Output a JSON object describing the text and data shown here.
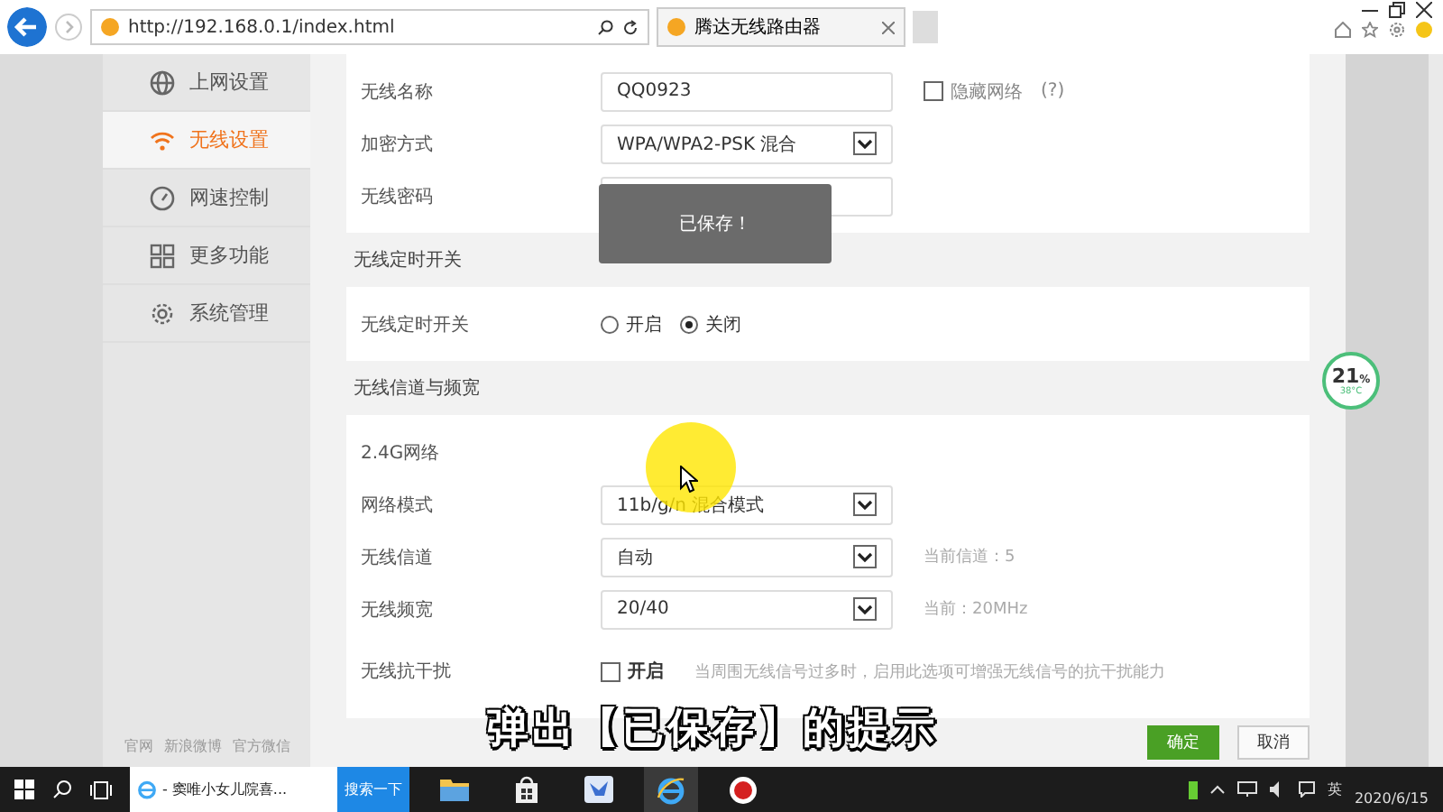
{
  "browser": {
    "address": "http://192.168.0.1/index.html",
    "tabs": [
      {
        "title": "腾达无线路由器"
      }
    ]
  },
  "sidebar": {
    "items": [
      {
        "label": "上网设置",
        "selected": false
      },
      {
        "label": "无线设置",
        "selected": true
      },
      {
        "label": "网速控制",
        "selected": false
      },
      {
        "label": "更多功能",
        "selected": false
      },
      {
        "label": "系统管理",
        "selected": false
      }
    ],
    "footer_links": [
      "官网",
      "新浪微博",
      "官方微信"
    ]
  },
  "sections": [
    {
      "rows": [
        {
          "kind": "input",
          "label": "无线名称",
          "value": "QQ0923",
          "checkbox": {
            "label": "隐藏网络",
            "checked": false,
            "help": "(?)"
          }
        },
        {
          "kind": "select",
          "label": "加密方式",
          "value": "WPA/WPA2-PSK 混合"
        },
        {
          "kind": "password",
          "label": "无线密码"
        }
      ]
    },
    {
      "title": "无线定时开关",
      "rows": [
        {
          "kind": "radio",
          "label": "无线定时开关",
          "options": [
            {
              "label": "开启",
              "selected": false
            },
            {
              "label": "关闭",
              "selected": true
            }
          ]
        }
      ]
    },
    {
      "title": "无线信道与频宽",
      "rows": [
        {
          "kind": "heading",
          "label": "2.4G网络"
        },
        {
          "kind": "select",
          "label": "网络模式",
          "value": "11b/g/n 混合模式"
        },
        {
          "kind": "select",
          "label": "无线信道",
          "value": "自动",
          "note": "当前信道：5"
        },
        {
          "kind": "select",
          "label": "无线频宽",
          "value": "20/40",
          "note": "当前：20MHz"
        },
        {
          "kind": "check",
          "label": "无线抗干扰",
          "checkbox": {
            "label": "开启",
            "checked": false
          },
          "note": "当周围无线信号过多时，启用此选项可增强无线信号的抗干扰能力"
        }
      ]
    }
  ],
  "toast": "已保存！",
  "buttons": [
    {
      "label": "确定",
      "kind": "primary"
    },
    {
      "label": "取消",
      "kind": "secondary"
    }
  ],
  "monitor": {
    "percent": "21",
    "unit": "%",
    "temp": "38°C"
  },
  "caption": "弹出【已保存】的提示",
  "taskbar": {
    "search_text": "- 窦唯小女儿院喜...",
    "search_button": "搜索一下",
    "apps": [
      {
        "selected": false
      },
      {
        "selected": false
      },
      {
        "selected": false
      },
      {
        "selected": true
      },
      {
        "selected": false
      }
    ],
    "tray_lang": "英",
    "date": "2020/6/15"
  }
}
